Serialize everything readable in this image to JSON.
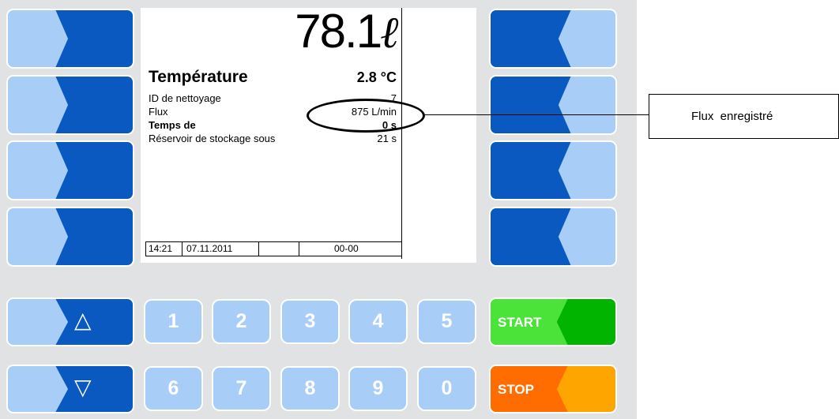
{
  "display": {
    "volume": "78.1",
    "volume_unit": "ℓ",
    "temperature_label": "Température",
    "temperature_value": "2.8 °C",
    "rows": [
      {
        "label": "ID de nettoyage",
        "value": "7"
      },
      {
        "label": "Flux",
        "value": "875 L/min"
      },
      {
        "label": "Temps de",
        "value": "0 s"
      },
      {
        "label": "Réservoir de stockage sous",
        "value": "21 s"
      }
    ],
    "status": {
      "time": "14:21",
      "date": "07.11.2011",
      "code": "00-00"
    }
  },
  "keypad": {
    "up_symbol": "△",
    "down_symbol": "▽",
    "digits_top": [
      "1",
      "2",
      "3",
      "4",
      "5"
    ],
    "digits_bottom": [
      "6",
      "7",
      "8",
      "9",
      "0"
    ],
    "start_label": "START",
    "stop_label": "STOP"
  },
  "callout": {
    "text": "Flux  enregistré"
  },
  "colors": {
    "panel": "#e1e2e4",
    "softkey_dark": "#0a59c1",
    "softkey_light": "#a8cdf7",
    "start_green_light": "#4be23a",
    "start_green_dark": "#00b400",
    "stop_orange_dark": "#ff6d00",
    "stop_orange_light": "#ffa500"
  }
}
